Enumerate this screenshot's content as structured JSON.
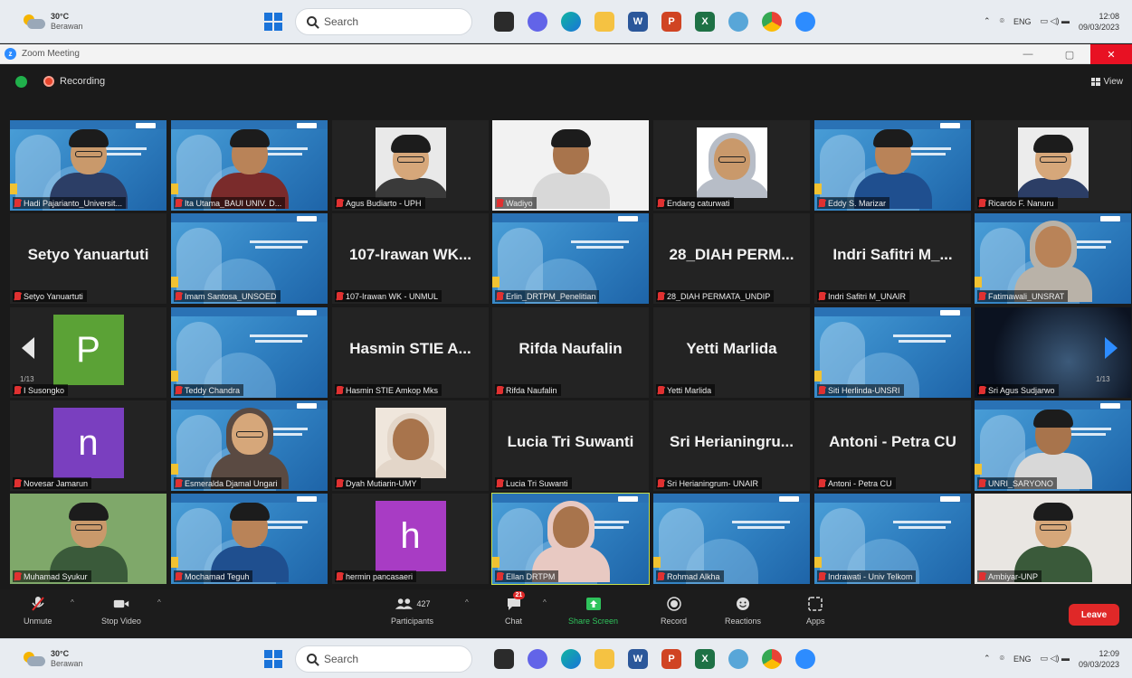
{
  "taskbar_top": {
    "temp": "30°C",
    "weather": "Berawan",
    "search_label": "Search",
    "lang": "ENG",
    "time": "12:08",
    "date": "09/03/2023"
  },
  "taskbar_bottom": {
    "temp": "30°C",
    "weather": "Berawan",
    "search_label": "Search",
    "lang": "ENG",
    "time": "12:09",
    "date": "09/03/2023"
  },
  "zoom_window": {
    "title": "Zoom Meeting",
    "minimize": "—",
    "maximize": "▢",
    "close": "✕"
  },
  "zoom_top": {
    "recording_label": "Recording",
    "view_label": "View"
  },
  "page": {
    "left": "1/13",
    "right": "1/13"
  },
  "tiles": [
    {
      "name": "Hadi Pajarianto_Universit..."
    },
    {
      "name": "Ita Utama_BAUI UNIV. D..."
    },
    {
      "name": "Agus Budiarto - UPH"
    },
    {
      "name": "Wadiyo"
    },
    {
      "name": "Endang caturwati"
    },
    {
      "name": "Eddy S. Marizar"
    },
    {
      "name": "Ricardo F. Nanuru"
    },
    {
      "name": "Setyo Yanuartuti",
      "big": "Setyo Yanuartuti"
    },
    {
      "name": "Imam Santosa_UNSOED"
    },
    {
      "name": "107-Irawan WK - UNMUL",
      "big": "107-Irawan WK..."
    },
    {
      "name": "Erlin_DRTPM_Penelitian"
    },
    {
      "name": "28_DIAH PERMATA_UNDIP",
      "big": "28_DIAH PERM..."
    },
    {
      "name": "Indri Safitri M_UNAIR",
      "big": "Indri Safitri M_..."
    },
    {
      "name": "Fatimawali_UNSRAT"
    },
    {
      "name": "I Susongko",
      "avatar": "P"
    },
    {
      "name": "Teddy Chandra"
    },
    {
      "name": "Hasmin STIE Amkop Mks",
      "big": "Hasmin STIE A..."
    },
    {
      "name": "Rifda Naufalin",
      "big": "Rifda Naufalin"
    },
    {
      "name": "Yetti Marlida",
      "big": "Yetti Marlida"
    },
    {
      "name": "Siti Herlinda-UNSRI"
    },
    {
      "name": "Sri Agus Sudjarwo"
    },
    {
      "name": "Novesar Jamarun",
      "avatar": "n"
    },
    {
      "name": "Esmeralda Djamal Ungari"
    },
    {
      "name": "Dyah Mutiarin-UMY"
    },
    {
      "name": "Lucia Tri Suwanti",
      "big": "Lucia Tri Suwanti"
    },
    {
      "name": "Sri Herianingrum- UNAIR",
      "big": "Sri Herianingru..."
    },
    {
      "name": "Antoni - Petra CU",
      "big": "Antoni - Petra CU"
    },
    {
      "name": "UNRI_SARYONO"
    },
    {
      "name": "Muhamad Syukur"
    },
    {
      "name": "Mochamad Teguh"
    },
    {
      "name": "hermin pancasaeri",
      "avatar": "h"
    },
    {
      "name": "Ellan DRTPM"
    },
    {
      "name": "Rohmad Alkha"
    },
    {
      "name": "Indrawati - Univ Telkom"
    },
    {
      "name": "Ambiyar-UNP"
    }
  ],
  "toolbar": {
    "unmute": "Unmute",
    "stop_video": "Stop Video",
    "participants": "Participants",
    "participant_count": "427",
    "chat": "Chat",
    "chat_badge": "21",
    "share_screen": "Share Screen",
    "record": "Record",
    "reactions": "Reactions",
    "apps": "Apps",
    "leave": "Leave"
  },
  "colors": {
    "accent": "#2d8cff",
    "leave": "#e02828",
    "share": "#2fc35c",
    "active_speaker": "#c8e04a"
  }
}
